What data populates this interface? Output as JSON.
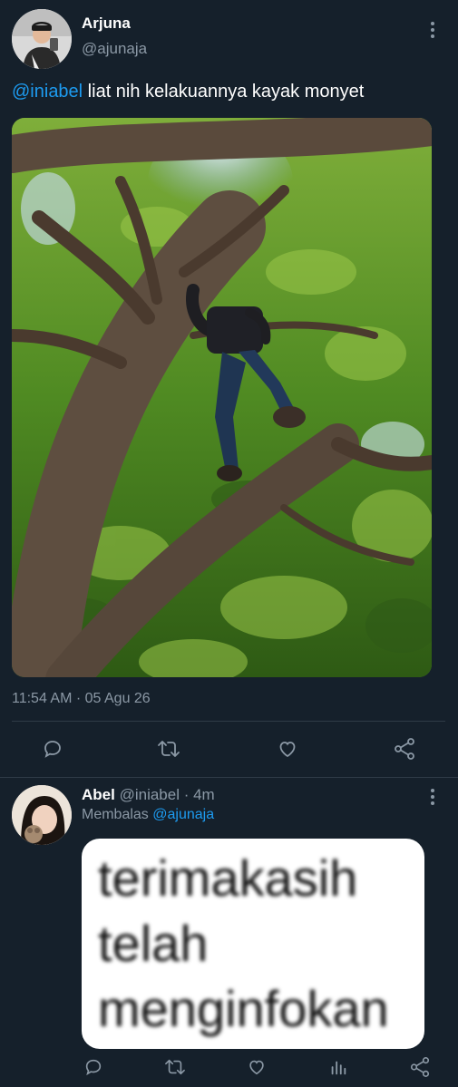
{
  "tweet": {
    "author_name": "Arjuna",
    "author_handle": "@ajunaja",
    "mention": "@iniabel",
    "text": " liat nih kelakuannya kayak monyet",
    "timestamp": "11:54 AM · 05 Agu 26",
    "photo_icon": "photo-tree-climbing"
  },
  "actions": {
    "reply_icon": "comment-icon",
    "retweet_icon": "retweet-icon",
    "like_icon": "heart-icon",
    "share_icon": "share-icon"
  },
  "reply": {
    "author_name": "Abel",
    "author_handle": "@iniabel",
    "time": " · 4m",
    "replying_label": "Membalas ",
    "replying_to": "@ajunaja",
    "sticker_text": "terimakasih\ntelah\nmenginfokan",
    "actions": [
      "comment-icon",
      "retweet-icon",
      "heart-icon",
      "analytics-icon",
      "share-icon"
    ]
  },
  "colors": {
    "background": "#15202b",
    "accent": "#1d9bf0",
    "muted": "#8b98a5",
    "divider": "#2f3b47"
  }
}
